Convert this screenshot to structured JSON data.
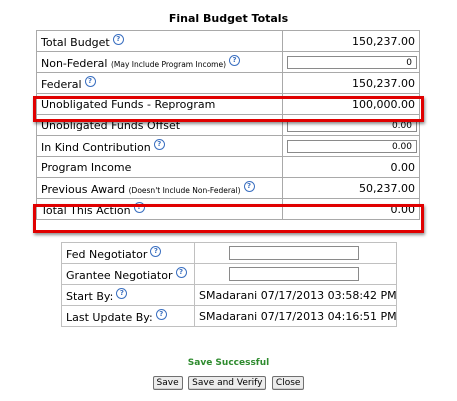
{
  "title": "Final Budget Totals",
  "rows": [
    {
      "label": "Total Budget",
      "sub": "",
      "value": "150,237.00",
      "type": "text"
    },
    {
      "label": "Non-Federal",
      "sub": "(May Include Program Income)",
      "value": "0",
      "type": "input"
    },
    {
      "label": "Federal",
      "sub": "",
      "value": "150,237.00",
      "type": "text"
    },
    {
      "label": "Unobligated Funds - Reprogram",
      "sub": "",
      "value": "100,000.00",
      "type": "text"
    },
    {
      "label": "Unobligated Funds Offset",
      "sub": "",
      "value": "0.00",
      "type": "input"
    },
    {
      "label": "In Kind Contribution",
      "sub": "",
      "value": "0.00",
      "type": "input"
    },
    {
      "label": "Program Income",
      "sub": "",
      "value": "0.00",
      "type": "text"
    },
    {
      "label": "Previous Award",
      "sub": "(Doesn't Include Non-Federal)",
      "value": "50,237.00",
      "type": "text"
    },
    {
      "label": "Total This Action",
      "sub": "",
      "value": "0.00",
      "type": "text"
    }
  ],
  "meta": {
    "fed_negotiator_label": "Fed Negotiator",
    "fed_negotiator_value": "",
    "grantee_negotiator_label": "Grantee Negotiator",
    "grantee_negotiator_value": "",
    "start_by_label": "Start By:",
    "start_by_value": "SMadarani 07/17/2013 03:58:42 PM",
    "last_update_label": "Last Update By:",
    "last_update_value": "SMadarani 07/17/2013 04:16:51 PM"
  },
  "status": "Save Successful",
  "buttons": {
    "save": "Save",
    "save_verify": "Save and Verify",
    "close": "Close"
  },
  "colors": {
    "highlight": "#e00000",
    "success": "#2e8b2e",
    "help_icon": "#3a6fc0"
  }
}
